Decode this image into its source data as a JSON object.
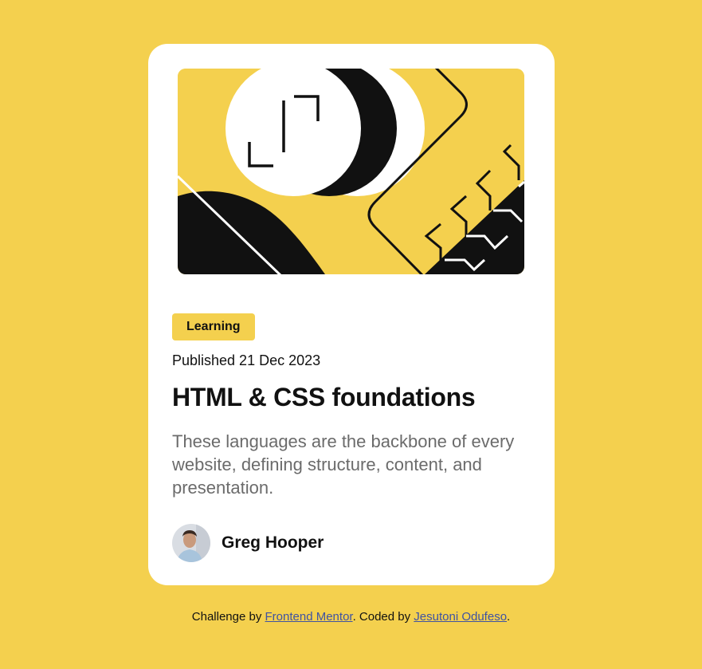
{
  "card": {
    "tag": "Learning",
    "published": "Published 21 Dec 2023",
    "title": "HTML & CSS foundations",
    "description": "These languages are the backbone of every website, defining structure, content, and presentation.",
    "author": {
      "name": "Greg Hooper"
    }
  },
  "attribution": {
    "prefix": "Challenge by ",
    "link1": "Frontend Mentor",
    "middle": ". Coded by ",
    "link2": "Jesutoni Odufeso",
    "suffix": "."
  },
  "colors": {
    "background": "#F4D04E",
    "card": "#FFFFFF",
    "text": "#111111",
    "muted": "#6B6B6B"
  },
  "icons": [
    "hero-illustration",
    "author-avatar"
  ]
}
